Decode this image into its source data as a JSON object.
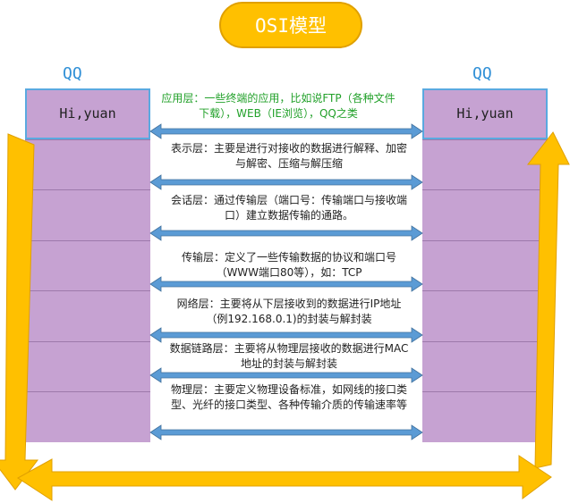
{
  "title": "OSI模型",
  "left_host": {
    "label": "QQ",
    "message": "Hi,yuan"
  },
  "right_host": {
    "label": "QQ",
    "message": "Hi,yuan"
  },
  "layers": [
    {
      "desc": "应用层：一些终端的应用，比如说FTP（各种文件下载），WEB（IE浏览），QQ之类"
    },
    {
      "desc": "表示层：主要是进行对接收的数据进行解释、加密与解密、压缩与解压缩"
    },
    {
      "desc": "会话层：通过传输层（端口号：传输端口与接收端口）建立数据传输的通路。"
    },
    {
      "desc": "传输层：定义了一些传输数据的协议和端口号（WWW端口80等），如：TCP"
    },
    {
      "desc": "网络层：主要将从下层接收到的数据进行IP地址（例192.168.0.1)的封装与解封装"
    },
    {
      "desc": "数据链路层：主要将从物理层接收的数据进行MAC地址的封装与解封装"
    },
    {
      "desc": "物理层：主要定义物理设备标准，如网线的接口类型、光纤的接口类型、各种传输介质的传输速率等"
    }
  ],
  "colors": {
    "layer_fill": "#c6a2d2",
    "arrow_orange": "#ffc000",
    "arrow_blue": "#5b9bd5",
    "title_fill": "#ffc000",
    "green_text": "#22a12a"
  }
}
